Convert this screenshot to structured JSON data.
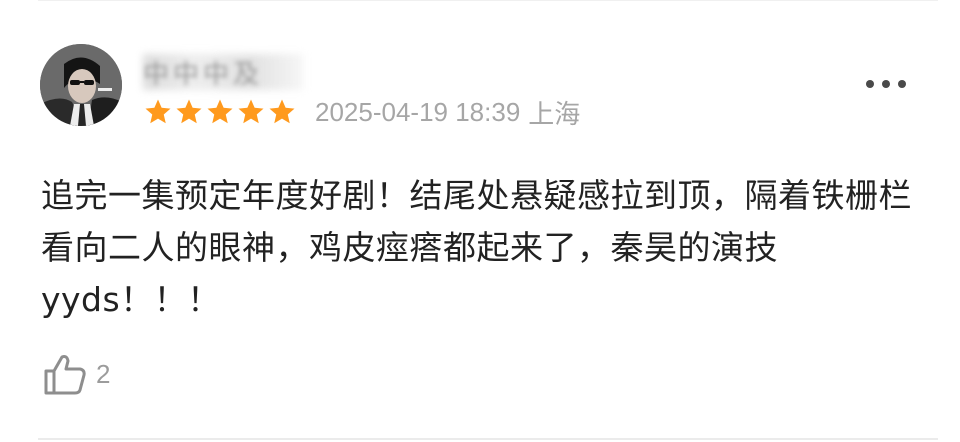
{
  "comment": {
    "username": "中中中及",
    "rating": 5,
    "rating_max": 5,
    "date": "2025-04-19 18:39",
    "location": "上海",
    "text": "追完一集预定年度好剧！结尾处悬疑感拉到顶，隔着铁栅栏看向二人的眼神，鸡皮痙瘩都起来了，秦昊的演技yyds！！！",
    "likes": "2"
  },
  "colors": {
    "star": "#ff9a1e",
    "meta_text": "#a6a6a6",
    "body_text": "#222222"
  },
  "icons": {
    "more": "more-dots-icon",
    "like": "thumbs-up-icon",
    "star": "star-icon"
  }
}
